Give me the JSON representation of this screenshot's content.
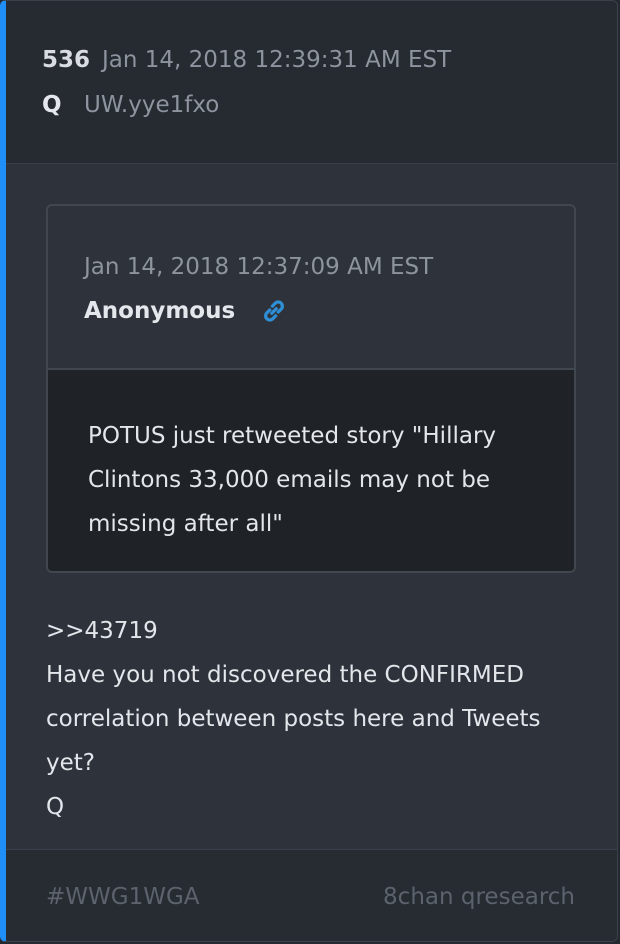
{
  "post": {
    "number": "536",
    "timestamp": "Jan 14, 2018 12:39:31 AM EST",
    "author": "Q",
    "tripcode": "UW.yye1fxo"
  },
  "quoted_post": {
    "timestamp": "Jan 14, 2018 12:37:09 AM EST",
    "author": "Anonymous",
    "link_icon": "link-icon",
    "text": "POTUS just retweeted story \"Hillary Clintons 33,000 emails may not be missing after all\""
  },
  "body": {
    "lines": [
      ">>43719",
      "Have you not discovered the CONFIRMED",
      "correlation between posts here and Tweets",
      "yet?",
      "Q"
    ]
  },
  "footer": {
    "hashtag": "#WWG1WGA",
    "source": "8chan qresearch"
  },
  "colors": {
    "accent": "#1f8ef6",
    "link": "#2f8fd6"
  }
}
